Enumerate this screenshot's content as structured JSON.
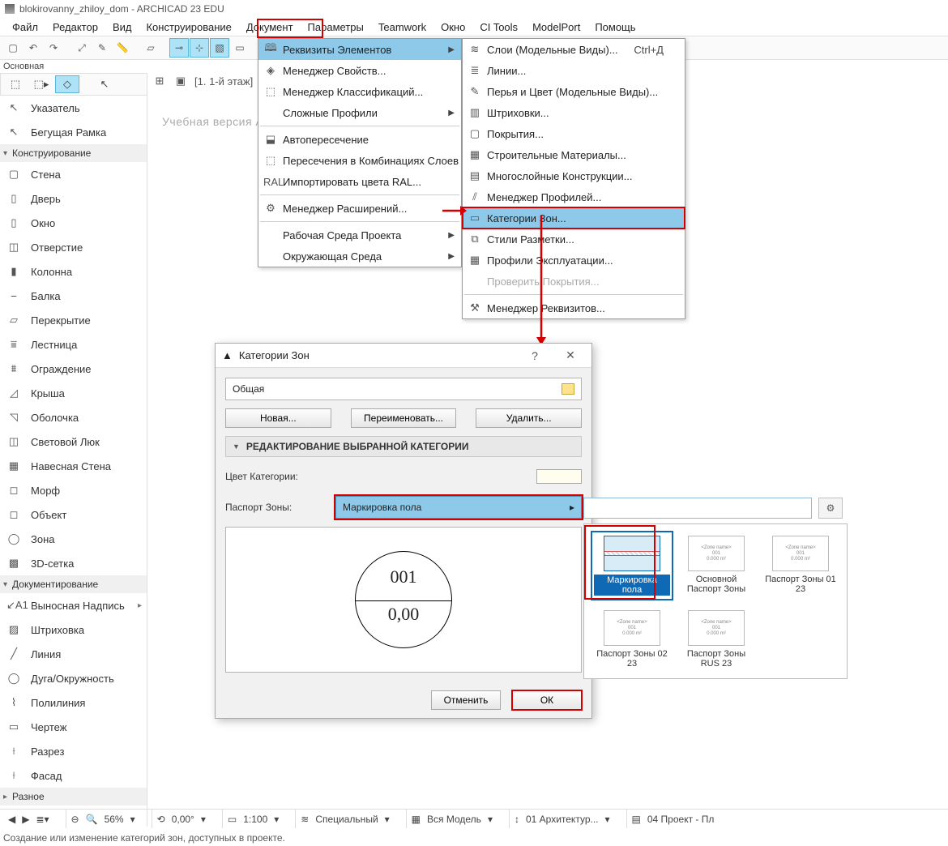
{
  "title": "blokirovanny_zhiloy_dom - ARCHICAD 23 EDU",
  "menubar": [
    "Файл",
    "Редактор",
    "Вид",
    "Конструирование",
    "Документ",
    "Параметры",
    "Teamwork",
    "Окно",
    "CI Tools",
    "ModelPort",
    "Помощь"
  ],
  "menubar_highlight_index": 5,
  "rowlabel": "Основная",
  "tabline": "[1. 1-й этаж]",
  "watermark": "Учебная версия ARCHI",
  "toolpanel": {
    "group1_title": "Конструирование",
    "designTools": [
      {
        "label": "Указатель"
      },
      {
        "label": "Бегущая Рамка"
      }
    ],
    "constructTools": [
      "Стена",
      "Дверь",
      "Окно",
      "Отверстие",
      "Колонна",
      "Балка",
      "Перекрытие",
      "Лестница",
      "Ограждение",
      "Крыша",
      "Оболочка",
      "Световой Люк",
      "Навесная Стена",
      "Морф",
      "Объект",
      "Зона",
      "3D-сетка"
    ],
    "docTitle": "Документирование",
    "docTools": [
      "Выносная Надпись",
      "Штриховка",
      "Линия",
      "Дуга/Окружность",
      "Полилиния",
      "Чертеж",
      "Разрез",
      "Фасад"
    ],
    "miscTitle": "Разное"
  },
  "menu1": [
    {
      "icon": "🕮",
      "label": "Реквизиты Элементов",
      "arrow": true,
      "hl": true
    },
    {
      "icon": "◈",
      "label": "Менеджер Свойств..."
    },
    {
      "icon": "⬚",
      "label": "Менеджер Классификаций..."
    },
    {
      "icon": "",
      "label": "Сложные Профили",
      "arrow": true
    },
    {
      "sep": true
    },
    {
      "icon": "⬓",
      "label": "Автопересечение"
    },
    {
      "icon": "⬚",
      "label": "Пересечения в Комбинациях Слоев"
    },
    {
      "icon": "RAL",
      "label": "Импортировать цвета RAL..."
    },
    {
      "sep": true
    },
    {
      "icon": "⚙",
      "label": "Менеджер Расширений..."
    },
    {
      "sep": true
    },
    {
      "icon": "",
      "label": "Рабочая Среда Проекта",
      "arrow": true
    },
    {
      "icon": "",
      "label": "Окружающая Среда",
      "arrow": true
    }
  ],
  "menu2": [
    {
      "icon": "≋",
      "label": "Слои (Модельные Виды)...",
      "kbd": "Ctrl+Д"
    },
    {
      "icon": "≣",
      "label": "Линии..."
    },
    {
      "icon": "✎",
      "label": "Перья и Цвет (Модельные Виды)..."
    },
    {
      "icon": "▥",
      "label": "Штриховки..."
    },
    {
      "icon": "▢",
      "label": "Покрытия..."
    },
    {
      "icon": "▦",
      "label": "Строительные Материалы..."
    },
    {
      "icon": "▤",
      "label": "Многослойные Конструкции..."
    },
    {
      "icon": "⫽",
      "label": "Менеджер Профилей..."
    },
    {
      "icon": "▭",
      "label": "Категории Зон...",
      "hl": true,
      "redbox": true
    },
    {
      "icon": "⧉",
      "label": "Стили Разметки..."
    },
    {
      "icon": "▦",
      "label": "Профили Эксплуатации..."
    },
    {
      "icon": "",
      "label": "Проверить Покрытия...",
      "disabled": true
    },
    {
      "sep": true
    },
    {
      "icon": "⚒",
      "label": "Менеджер Реквизитов..."
    }
  ],
  "dialog": {
    "title": "Категории Зон",
    "category": "Общая",
    "buttons": {
      "new": "Новая...",
      "rename": "Переименовать...",
      "del": "Удалить..."
    },
    "section": "РЕДАКТИРОВАНИЕ ВЫБРАННОЙ КАТЕГОРИИ",
    "propColor": "Цвет Категории:",
    "propPassport": "Паспорт Зоны:",
    "passportValue": "Маркировка пола",
    "circleTop": "001",
    "circleBottom": "0,00",
    "cancel": "Отменить",
    "ok": "ОК"
  },
  "stamps": [
    {
      "cap": "Маркировка пола",
      "sel": true
    },
    {
      "cap": "Основной Паспорт Зоны"
    },
    {
      "cap": "Паспорт Зоны 01 23"
    },
    {
      "cap": "Паспорт Зоны 02 23"
    },
    {
      "cap": "Паспорт Зоны RUS 23"
    }
  ],
  "status": {
    "zoom": "56%",
    "angle": "0,00°",
    "scale": "1:100",
    "layers": "Специальный",
    "model": "Вся Модель",
    "arch": "01 Архитектур...",
    "proj": "04 Проект - Пл"
  },
  "helpline": "Создание или изменение категорий зон, доступных в проекте."
}
